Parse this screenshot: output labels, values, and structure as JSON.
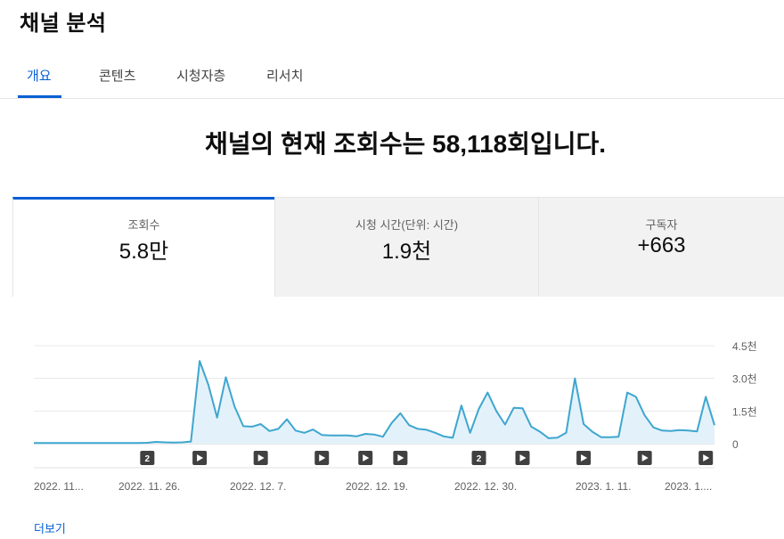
{
  "header": {
    "title": "채널 분석"
  },
  "tabs": [
    {
      "label": "개요",
      "active": true
    },
    {
      "label": "콘텐츠",
      "active": false
    },
    {
      "label": "시청자층",
      "active": false
    },
    {
      "label": "리서치",
      "active": false
    }
  ],
  "headline": "채널의 현재 조회수는 58,118회입니다.",
  "metrics": [
    {
      "label": "조회수",
      "value": "5.8만",
      "selected": true
    },
    {
      "label": "시청 시간(단위: 시간)",
      "value": "1.9천",
      "selected": false
    },
    {
      "label": "구독자",
      "value": "+663",
      "selected": false
    }
  ],
  "colors": {
    "accent": "#065fd4",
    "line": "#3ea6cf",
    "fill": "#e3f2fa"
  },
  "chart_data": {
    "type": "area",
    "y_tick_labels": [
      "4.5천",
      "3.0천",
      "1.5천",
      "0"
    ],
    "ylim": [
      0,
      4500
    ],
    "x_tick_labels": [
      "2022. 11...",
      "2022. 11. 26.",
      "2022. 12. 7.",
      "2022. 12. 19.",
      "2022. 12. 30.",
      "2023. 1. 11.",
      "2023. 1...."
    ],
    "grid": true,
    "values": [
      30,
      30,
      30,
      30,
      30,
      30,
      30,
      30,
      30,
      30,
      30,
      30,
      30,
      40,
      80,
      60,
      50,
      60,
      100,
      3800,
      2700,
      1200,
      3050,
      1700,
      800,
      780,
      900,
      580,
      680,
      1120,
      600,
      500,
      650,
      400,
      380,
      380,
      380,
      340,
      450,
      420,
      320,
      950,
      1400,
      850,
      680,
      640,
      500,
      330,
      270,
      1750,
      500,
      1600,
      2350,
      1500,
      880,
      1650,
      1630,
      780,
      550,
      250,
      280,
      500,
      3000,
      900,
      550,
      300,
      300,
      320,
      2350,
      2150,
      1300,
      750,
      600,
      580,
      620,
      600,
      560,
      2150,
      850
    ],
    "markers": [
      {
        "index": 13,
        "kind": "2"
      },
      {
        "index": 19,
        "kind": "play"
      },
      {
        "index": 26,
        "kind": "play"
      },
      {
        "index": 33,
        "kind": "play"
      },
      {
        "index": 38,
        "kind": "play"
      },
      {
        "index": 42,
        "kind": "play"
      },
      {
        "index": 51,
        "kind": "2"
      },
      {
        "index": 56,
        "kind": "play"
      },
      {
        "index": 63,
        "kind": "play"
      },
      {
        "index": 70,
        "kind": "play"
      },
      {
        "index": 77,
        "kind": "play"
      }
    ]
  },
  "footer": {
    "more_label": "더보기"
  }
}
